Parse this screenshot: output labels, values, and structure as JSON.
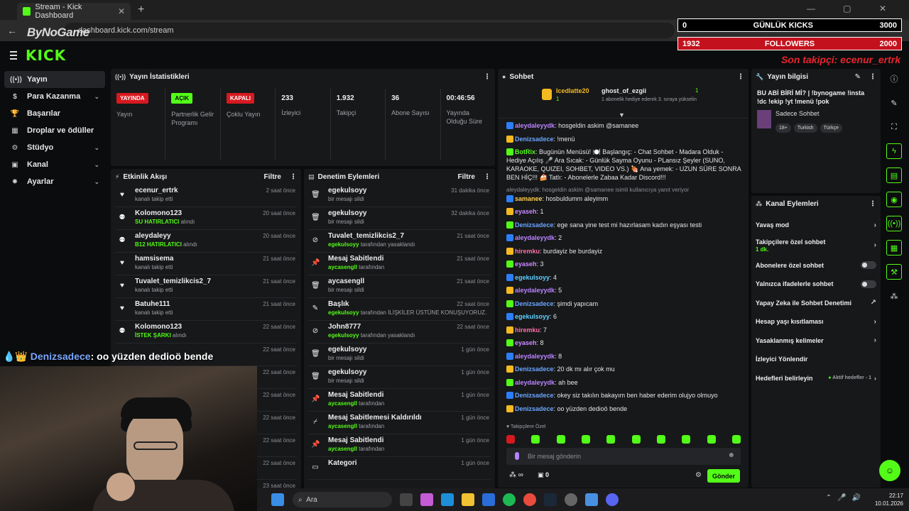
{
  "browser": {
    "tab_title": "Stream - Kick Dashboard",
    "url": "dashboard.kick.com/stream",
    "watermark": "ByNoGame"
  },
  "overlays": {
    "kicks_left": "0",
    "kicks_label": "GÜNLÜK KICKS",
    "kicks_right": "3000",
    "followers_left": "1932",
    "followers_label": "FOLLOWERS",
    "followers_right": "2000",
    "last_follower": "Son takipçi: ecenur_ertrk"
  },
  "brand": {
    "logo": "KICK"
  },
  "nav": {
    "items": [
      {
        "label": "Yayın",
        "icon": "broadcast-icon"
      },
      {
        "label": "Para Kazanma",
        "icon": "dollar-icon"
      },
      {
        "label": "Başarılar",
        "icon": "trophy-icon"
      },
      {
        "label": "Droplar ve ödüller",
        "icon": "gift-icon"
      },
      {
        "label": "Stüdyo",
        "icon": "studio-icon"
      },
      {
        "label": "Kanal",
        "icon": "channel-icon"
      },
      {
        "label": "Ayarlar",
        "icon": "gear-icon"
      }
    ]
  },
  "stats": {
    "title": "Yayın İstatistikleri",
    "live_badge": "YAYINDA",
    "live_label": "Yayın",
    "partner_badge": "AÇIK",
    "partner_label": "Partnerlik Gelir Programı",
    "multi_badge": "KAPALI",
    "multi_label": "Çoklu Yayın",
    "viewers": "233",
    "viewers_label": "İzleyici",
    "followers": "1.932",
    "followers_label": "Takipçi",
    "subs": "36",
    "subs_label": "Abone Sayısı",
    "uptime": "00:46:56",
    "uptime_label": "Yayında Olduğu Süre"
  },
  "activity": {
    "title": "Etkinlik Akışı",
    "filter": "Filtre",
    "items": [
      {
        "name": "ecenur_ertrk",
        "pre": "",
        "detail": "kanalı takip etti",
        "time": "2 saat önce",
        "icon": "heart-icon"
      },
      {
        "name": "Kolomono123",
        "pre": "SU HATIRLATICI",
        "detail": "alındı",
        "time": "20 saat önce",
        "icon": "kick-coin-icon"
      },
      {
        "name": "aleydaleyy",
        "pre": "B12 HATIRLATICI",
        "detail": "alındı",
        "time": "20 saat önce",
        "icon": "kick-coin-icon"
      },
      {
        "name": "hamsisema",
        "pre": "",
        "detail": "kanalı takip etti",
        "time": "21 saat önce",
        "icon": "heart-icon"
      },
      {
        "name": "Tuvalet_temizlikcis2_7",
        "pre": "",
        "detail": "kanalı takip etti",
        "time": "21 saat önce",
        "icon": "heart-icon"
      },
      {
        "name": "Batuhe111",
        "pre": "",
        "detail": "kanalı takip etti",
        "time": "21 saat önce",
        "icon": "heart-icon"
      },
      {
        "name": "Kolomono123",
        "pre": "İSTEK ŞARKI",
        "detail": "alındı",
        "time": "22 saat önce",
        "icon": "kick-coin-icon"
      }
    ],
    "extra_times": [
      "22 saat önce",
      "22 saat önce",
      "22 saat önce",
      "22 saat önce",
      "22 saat önce",
      "22 saat önce",
      "23 saat önce"
    ]
  },
  "moderation": {
    "title": "Denetim Eylemleri",
    "filter": "Filtre",
    "items": [
      {
        "name": "egekulsoyy",
        "pre": "",
        "detail": "bir mesajı sildi",
        "time": "31 dakika önce",
        "icon": "trash-icon"
      },
      {
        "name": "egekulsoyy",
        "pre": "",
        "detail": "bir mesajı sildi",
        "time": "32 dakika önce",
        "icon": "trash-icon"
      },
      {
        "name": "Tuvalet_temizlikcis2_7",
        "pre": "egekulsoyy",
        "detail": "tarafından yasaklandı",
        "time": "21 saat önce",
        "icon": "ban-icon"
      },
      {
        "name": "Mesaj Sabitlendi",
        "pre": "aycasengll",
        "detail": "tarafından",
        "time": "21 saat önce",
        "icon": "pin-icon"
      },
      {
        "name": "aycasengll",
        "pre": "",
        "detail": "bir mesajı sildi",
        "time": "21 saat önce",
        "icon": "trash-icon"
      },
      {
        "name": "Başlık",
        "pre": "egekulsoyy",
        "detail": "tarafından İLİŞKİLER ÜSTÜNE KONUŞUYORUZ... | !bynogame !insta !dc !ekip !yt !menü !pok olarak değiştirildi",
        "time": "22 saat önce",
        "icon": "title-icon"
      },
      {
        "name": "John8777",
        "pre": "egekulsoyy",
        "detail": "tarafından yasaklandı",
        "time": "22 saat önce",
        "icon": "ban-icon"
      },
      {
        "name": "egekulsoyy",
        "pre": "",
        "detail": "bir mesajı sildi",
        "time": "1 gün önce",
        "icon": "trash-icon"
      },
      {
        "name": "egekulsoyy",
        "pre": "",
        "detail": "bir mesajı sildi",
        "time": "1 gün önce",
        "icon": "trash-icon"
      },
      {
        "name": "Mesaj Sabitlendi",
        "pre": "aycasengll",
        "detail": "tarafından",
        "time": "1 gün önce",
        "icon": "pin-icon"
      },
      {
        "name": "Mesaj Sabitlemesi Kaldırıldı",
        "pre": "aycasengll",
        "detail": "tarafından",
        "time": "1 gün önce",
        "icon": "unpin-icon"
      },
      {
        "name": "Mesaj Sabitlendi",
        "pre": "aycasengll",
        "detail": "tarafından",
        "time": "1 gün önce",
        "icon": "pin-icon"
      },
      {
        "name": "Kategori",
        "pre": "",
        "detail": "",
        "time": "1 gün önce",
        "icon": "category-icon"
      }
    ]
  },
  "chat": {
    "title": "Sohbet",
    "gifter": "Icedlatte20",
    "gifter_count": "1",
    "recipient": "ghost_of_ezgii",
    "recipient_count": "1",
    "gift_note": "1 abonelik hediye ederek 3. sıraya yükselin",
    "reply_note": "aleydaleyydk: hosgeldin askim @samanee isimli kullanıcıya yanıt veriyor",
    "messages": [
      {
        "user": "aleydaleyydk",
        "text": "hosgeldin askim @samanee",
        "color": "#b983ff"
      },
      {
        "user": "Denizsadece",
        "text": "!menü",
        "color": "#6aa5ff"
      },
      {
        "user": "BotRix",
        "text": "Bugünün Menüsü! 🍽️ Başlangıç: - Chat Sohbet - Madara Olduk - Hediye Açılış 🎤 Ara Sıcak: - Günlük Sayma Oyunu - PLansız Şeyler (SUNO, KARAOKE, QUIZEI, SOHBET, VIDEO VS.) 🍖 Ana yemek: - UZUN SÜRE SONRA BEN HİÇ!!! 🍰 Tatlı: - Abonelerle Zabaa Kadar Discord!!!",
        "color": "#53fc18"
      },
      {
        "user": "samanee",
        "text": "hosbuldumm aleyimm",
        "color": "#ffd04d"
      },
      {
        "user": "eyaseh",
        "text": "1",
        "color": "#c98bff"
      },
      {
        "user": "Denizsadece",
        "text": "ege sana yine test mi hazırlasam kadın eşyası testi",
        "color": "#6aa5ff"
      },
      {
        "user": "aleydaleyydk",
        "text": "2",
        "color": "#b983ff"
      },
      {
        "user": "hiremku",
        "text": "burdayiz be burdayiz",
        "color": "#ff6fa8"
      },
      {
        "user": "eyaseh",
        "text": "3",
        "color": "#c98bff"
      },
      {
        "user": "egekulsoyy",
        "text": "4",
        "color": "#5fd0ff"
      },
      {
        "user": "aleydaleyydk",
        "text": "5",
        "color": "#b983ff"
      },
      {
        "user": "Denizsadece",
        "text": "şimdi yapıcam",
        "color": "#6aa5ff"
      },
      {
        "user": "egekulsoyy",
        "text": "6",
        "color": "#5fd0ff"
      },
      {
        "user": "hiremku",
        "text": "7",
        "color": "#ff6fa8"
      },
      {
        "user": "eyaseh",
        "text": "8",
        "color": "#c98bff"
      },
      {
        "user": "aleydaleyydk",
        "text": "8",
        "color": "#b983ff"
      },
      {
        "user": "Denizsadece",
        "text": "20 dk mı alır çok mu",
        "color": "#6aa5ff"
      },
      {
        "user": "aleydaleyydk",
        "text": "ah bee",
        "color": "#b983ff"
      },
      {
        "user": "Denizsadece",
        "text": "okey siz takılın bakayım ben haber ederim olujyo olmuyo",
        "color": "#6aa5ff"
      },
      {
        "user": "Denizsadece",
        "text": "oo yüzden dedioö bende",
        "color": "#6aa5ff"
      }
    ],
    "followers_only": "Takipçilere Özel",
    "input_placeholder": "Bir mesaj gönderin",
    "points": "∞",
    "gift_count": "0",
    "send": "Gönder"
  },
  "info": {
    "title": "Yayın bilgisi",
    "stream_title": "BU ABİ BİRİ Mİ? | !bynogame !insta !dc !ekip !yt !menü !pok",
    "category": "Sadece Sohbet",
    "tags": [
      "18+",
      "Turkish",
      "Türkçe"
    ]
  },
  "actions": {
    "title": "Kanal Eylemleri",
    "slow_mode": "Yavaş mod",
    "followers_chat": "Takipçilere özel sohbet",
    "followers_chat_sub": "1 dk.",
    "subs_chat": "Abonelere özel sohbet",
    "emote_only": "Yalnızca ifadelerle sohbet",
    "ai_mod": "Yapay Zeka ile Sohbet Denetimi",
    "age_restrict": "Hesap yaşı kısıtlaması",
    "banned_words": "Yasaklanmış kelimeler",
    "redirect": "İzleyici Yönlendir",
    "goals": "Hedefleri belirleyin",
    "goals_status": "Aktif hedefler - 1"
  },
  "caption": {
    "user": "Denizsadece",
    "text": ": oo yüzden dedioö bende"
  },
  "taskbar": {
    "search": "Ara",
    "time": "22:17",
    "date": "10.01.2026"
  }
}
